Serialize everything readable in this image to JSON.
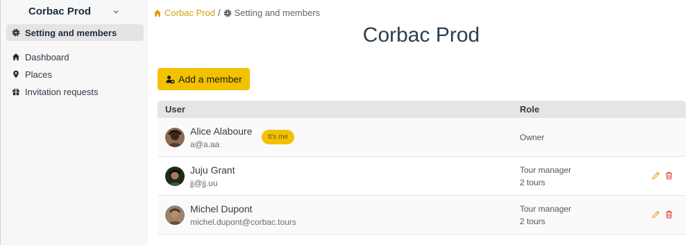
{
  "sidebar": {
    "org_name": "Corbac Prod",
    "items": [
      {
        "label": "Setting and members",
        "icon": "gear-icon",
        "active": true
      },
      {
        "label": "Dashboard",
        "icon": "home-icon"
      },
      {
        "label": "Places",
        "icon": "map-pin-icon"
      },
      {
        "label": "Invitation requests",
        "icon": "gift-icon"
      }
    ]
  },
  "breadcrumb": {
    "home": "Corbac Prod",
    "separator": "/",
    "current": "Setting and members"
  },
  "page": {
    "title": "Corbac Prod",
    "add_member_label": "Add a member"
  },
  "table": {
    "headers": {
      "user": "User",
      "role": "Role"
    },
    "rows": [
      {
        "name": "Alice Alaboure",
        "email": "a@a.aa",
        "badge": "It's me",
        "role": "Owner",
        "tours": ""
      },
      {
        "name": "Juju Grant",
        "email": "jj@jj.uu",
        "role": "Tour manager",
        "tours": "2 tours"
      },
      {
        "name": "Michel Dupont",
        "email": "michel.dupont@corbac.tours",
        "role": "Tour manager",
        "tours": "2 tours"
      }
    ]
  },
  "colors": {
    "accent": "#f2c200",
    "link": "#d4a00e",
    "delete": "#e0403a",
    "edit": "#e8a317"
  }
}
